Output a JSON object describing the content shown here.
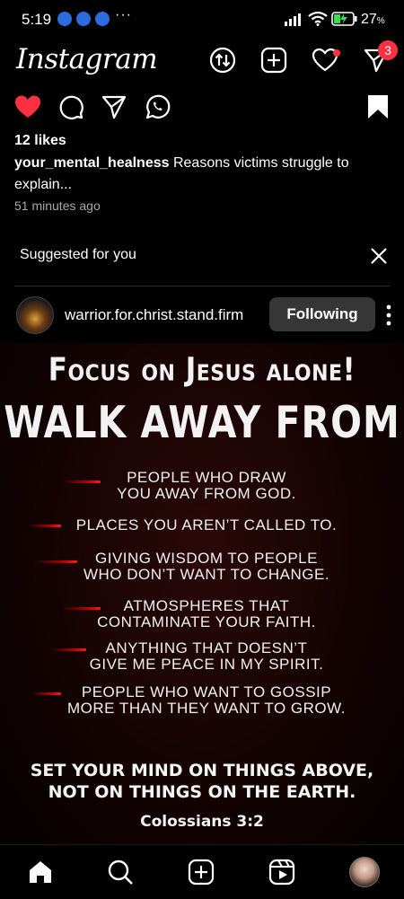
{
  "status_bar": {
    "time": "5:19",
    "more": "···",
    "battery": "27",
    "battery_unit": "%"
  },
  "header": {
    "logo": "Instagram",
    "notification_badge": "3"
  },
  "post_actions": {
    "likes": "12 likes"
  },
  "caption": {
    "username": "your_mental_healness",
    "text": " Reasons victims struggle to explain...",
    "time_ago": "51 minutes ago"
  },
  "suggested": {
    "label": "Suggested for you"
  },
  "suggested_post": {
    "username": "warrior.for.christ.stand.firm",
    "follow_label": "Following",
    "image": {
      "title": "Focus on Jesus alone!",
      "headline": "WALK AWAY FROM",
      "items": [
        [
          "PEOPLE WHO DRAW",
          "YOU AWAY FROM GOD."
        ],
        [
          "PLACES YOU AREN’T CALLED TO."
        ],
        [
          "GIVING WISDOM TO PEOPLE",
          "WHO DON’T WANT TO CHANGE."
        ],
        [
          "ATMOSPHERES THAT",
          "CONTAMINATE YOUR FAITH."
        ],
        [
          "ANYTHING THAT DOESN’T",
          "GIVE ME PEACE IN MY SPIRIT."
        ],
        [
          "PEOPLE WHO WANT TO GOSSIP",
          "MORE THAN THEY WANT TO GROW."
        ]
      ],
      "verse_line1": "SET YOUR MIND ON THINGS ABOVE,",
      "verse_line2": "NOT ON THINGS ON THE EARTH.",
      "reference": "Colossians 3:2"
    }
  },
  "colors": {
    "background": "#000000",
    "accent_red": "#ff3040",
    "button_bg": "#363636"
  },
  "icons": [
    "messenger-icon",
    "facebook-icon",
    "signal-icon",
    "wifi-icon",
    "battery-icon",
    "swap-icon",
    "new-post-icon",
    "heart-icon",
    "direct-icon",
    "comment-icon",
    "whatsapp-icon",
    "bookmark-icon",
    "close-icon",
    "more-icon",
    "home-icon",
    "search-icon",
    "reels-icon"
  ]
}
